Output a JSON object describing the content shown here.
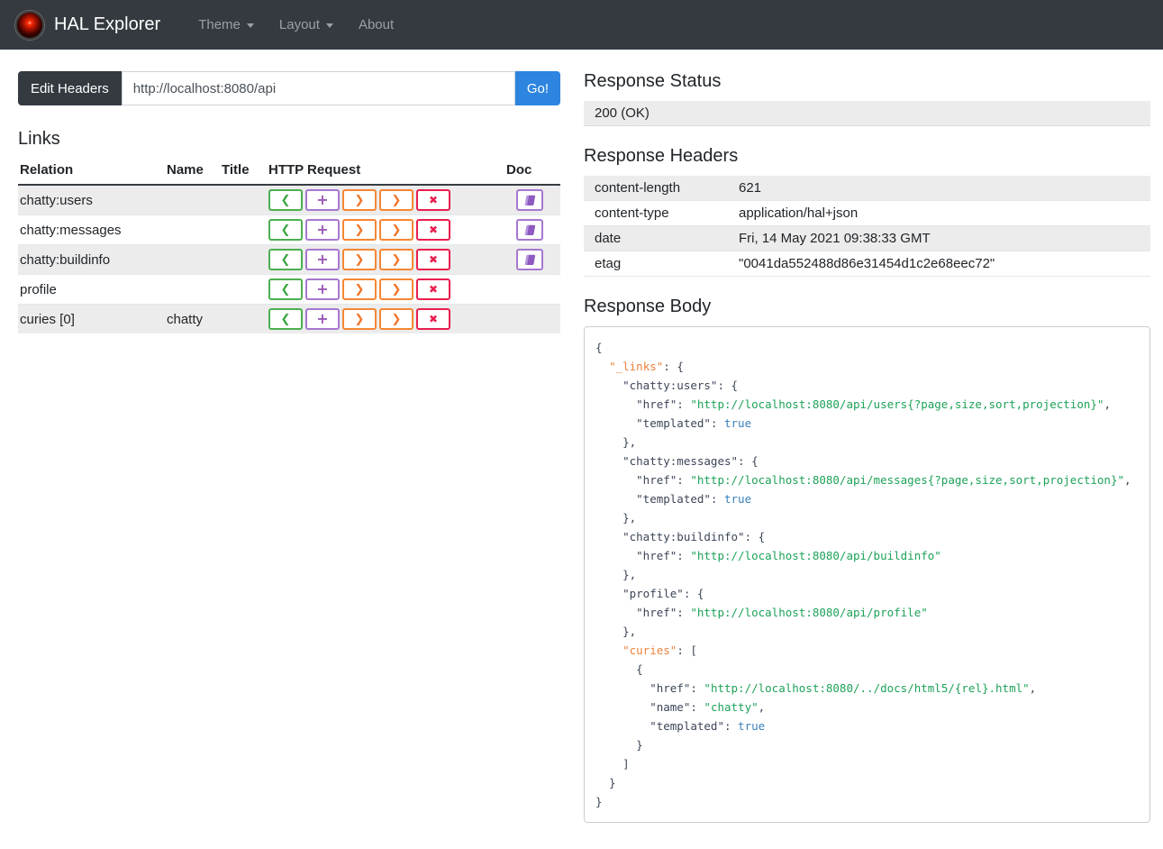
{
  "navbar": {
    "brand": "HAL Explorer",
    "items": [
      {
        "label": "Theme",
        "caret": true
      },
      {
        "label": "Layout",
        "caret": true
      },
      {
        "label": "About",
        "caret": false
      }
    ]
  },
  "address_bar": {
    "edit_headers_label": "Edit Headers",
    "url_value": "http://localhost:8080/api",
    "go_label": "Go!"
  },
  "links": {
    "title": "Links",
    "columns": [
      "Relation",
      "Name",
      "Title",
      "HTTP Request",
      "Doc"
    ],
    "http_buttons": [
      {
        "name": "get-request-button",
        "glyph": "❮",
        "cls": "btn-get"
      },
      {
        "name": "post-request-button",
        "glyph": "+",
        "cls": "btn-post"
      },
      {
        "name": "put-request-button",
        "glyph": "❯",
        "cls": "btn-put"
      },
      {
        "name": "patch-request-button",
        "glyph": "❯",
        "cls": "btn-patch"
      },
      {
        "name": "delete-request-button",
        "glyph": "✖",
        "cls": "btn-delete"
      }
    ],
    "rows": [
      {
        "relation": "chatty:users",
        "name": "",
        "title": "",
        "doc": true
      },
      {
        "relation": "chatty:messages",
        "name": "",
        "title": "",
        "doc": true
      },
      {
        "relation": "chatty:buildinfo",
        "name": "",
        "title": "",
        "doc": true
      },
      {
        "relation": "profile",
        "name": "",
        "title": "",
        "doc": false
      },
      {
        "relation": "curies [0]",
        "name": "chatty",
        "title": "",
        "doc": false
      }
    ]
  },
  "response_status": {
    "title": "Response Status",
    "value": "200 (OK)"
  },
  "response_headers": {
    "title": "Response Headers",
    "rows": [
      {
        "name": "content-length",
        "value": "621"
      },
      {
        "name": "content-type",
        "value": "application/hal+json"
      },
      {
        "name": "date",
        "value": "Fri, 14 May 2021 09:38:33 GMT"
      },
      {
        "name": "etag",
        "value": "\"0041da552488d86e31454d1c2e68eec72\""
      }
    ]
  },
  "response_body": {
    "title": "Response Body",
    "lines": [
      [
        [
          "d",
          "{"
        ]
      ],
      [
        [
          "d",
          "  "
        ],
        [
          "hk",
          "\"_links\""
        ],
        [
          "d",
          ": {"
        ]
      ],
      [
        [
          "d",
          "    \"chatty:users\": {"
        ]
      ],
      [
        [
          "d",
          "      \"href\": "
        ],
        [
          "s",
          "\"http://localhost:8080/api/users{?page,size,sort,projection}\""
        ],
        [
          "d",
          ","
        ]
      ],
      [
        [
          "d",
          "      \"templated\": "
        ],
        [
          "b",
          "true"
        ]
      ],
      [
        [
          "d",
          "    },"
        ]
      ],
      [
        [
          "d",
          "    \"chatty:messages\": {"
        ]
      ],
      [
        [
          "d",
          "      \"href\": "
        ],
        [
          "s",
          "\"http://localhost:8080/api/messages{?page,size,sort,projection}\""
        ],
        [
          "d",
          ","
        ]
      ],
      [
        [
          "d",
          "      \"templated\": "
        ],
        [
          "b",
          "true"
        ]
      ],
      [
        [
          "d",
          "    },"
        ]
      ],
      [
        [
          "d",
          "    \"chatty:buildinfo\": {"
        ]
      ],
      [
        [
          "d",
          "      \"href\": "
        ],
        [
          "s",
          "\"http://localhost:8080/api/buildinfo\""
        ]
      ],
      [
        [
          "d",
          "    },"
        ]
      ],
      [
        [
          "d",
          "    \"profile\": {"
        ]
      ],
      [
        [
          "d",
          "      \"href\": "
        ],
        [
          "s",
          "\"http://localhost:8080/api/profile\""
        ]
      ],
      [
        [
          "d",
          "    },"
        ]
      ],
      [
        [
          "d",
          "    "
        ],
        [
          "hk",
          "\"curies\""
        ],
        [
          "d",
          ": ["
        ]
      ],
      [
        [
          "d",
          "      {"
        ]
      ],
      [
        [
          "d",
          "        \"href\": "
        ],
        [
          "s",
          "\"http://localhost:8080/../docs/html5/{rel}.html\""
        ],
        [
          "d",
          ","
        ]
      ],
      [
        [
          "d",
          "        \"name\": "
        ],
        [
          "s",
          "\"chatty\""
        ],
        [
          "d",
          ","
        ]
      ],
      [
        [
          "d",
          "        \"templated\": "
        ],
        [
          "b",
          "true"
        ]
      ],
      [
        [
          "d",
          "      }"
        ]
      ],
      [
        [
          "d",
          "    ]"
        ]
      ],
      [
        [
          "d",
          "  }"
        ]
      ],
      [
        [
          "d",
          "}"
        ]
      ]
    ]
  },
  "colors": {
    "navbar_bg": "#343a40",
    "edit_headers_button": "#343a40",
    "go_button_blue": "#2d85e0",
    "get_green": "#43a047",
    "post_purple": "#9b59b6",
    "put_patch_orange": "#f0762b",
    "delete_red": "#e91e4f",
    "doc_purple": "#8d5bbf",
    "stripe_gray": "#ececec",
    "json_key_dark": "#3c4557",
    "json_hal_key_orange": "#ed823d",
    "json_string_green": "#1da258",
    "json_boolean_blue": "#3a80ba",
    "logo_eye_red": "#cc1100"
  }
}
